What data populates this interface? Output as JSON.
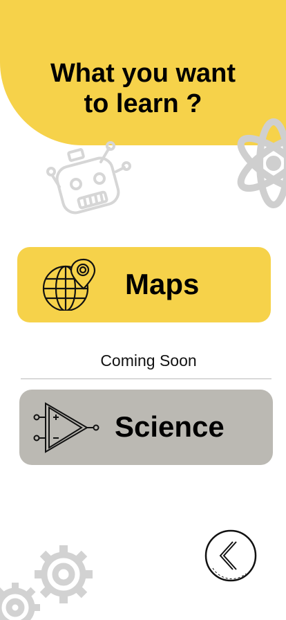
{
  "header": {
    "title_line1": "What you want",
    "title_line2": "to learn ?"
  },
  "decorations": {
    "robot_icon": "robot-icon",
    "atom_icon": "atom-icon",
    "gear_icon": "gear-icon"
  },
  "cards": {
    "maps": {
      "label": "Maps",
      "icon": "globe-location-icon"
    },
    "science": {
      "label": "Science",
      "icon": "op-amp-icon",
      "status": "Coming Soon"
    }
  },
  "navigation": {
    "back_icon": "chevron-left-icon"
  },
  "colors": {
    "accent": "#f6d24a",
    "disabled": "#bbb9b3",
    "decor": "#d9d9d9"
  }
}
